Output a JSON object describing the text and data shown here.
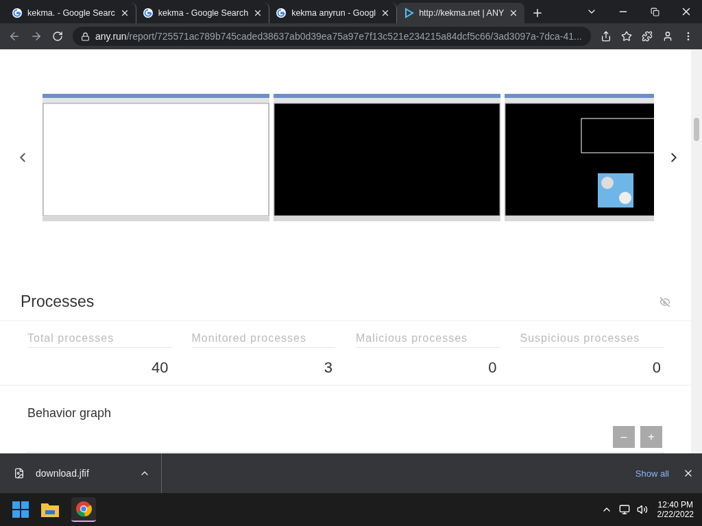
{
  "tabs": [
    {
      "title": "kekma. - Google Searc",
      "kind": "search",
      "selected": false
    },
    {
      "title": "kekma - Google Search",
      "kind": "search",
      "selected": false
    },
    {
      "title": "kekma anyrun - Googl",
      "kind": "search",
      "selected": false
    },
    {
      "title": "http://kekma.net | ANY",
      "kind": "report",
      "selected": true
    }
  ],
  "address": {
    "host": "any.run",
    "path": "/report/725571ac789b745caded38637ab0d39ea75a97e7f13c521e234215a84dcf5c66/3ad3097a-7dca-41..."
  },
  "carousel": {
    "slides": [
      {
        "kind": "blank"
      },
      {
        "kind": "dark"
      },
      {
        "kind": "dialog"
      }
    ]
  },
  "processes": {
    "title": "Processes",
    "stats": [
      {
        "label": "Total processes",
        "value": "40"
      },
      {
        "label": "Monitored processes",
        "value": "3"
      },
      {
        "label": "Malicious processes",
        "value": "0"
      },
      {
        "label": "Suspicious processes",
        "value": "0"
      }
    ]
  },
  "behavior": {
    "title": "Behavior graph",
    "zoom_out": "–",
    "zoom_in": "+"
  },
  "download_bar": {
    "file": "download.jfif",
    "show_all": "Show all"
  },
  "taskbar": {
    "time": "12:40 PM",
    "date": "2/22/2022"
  }
}
